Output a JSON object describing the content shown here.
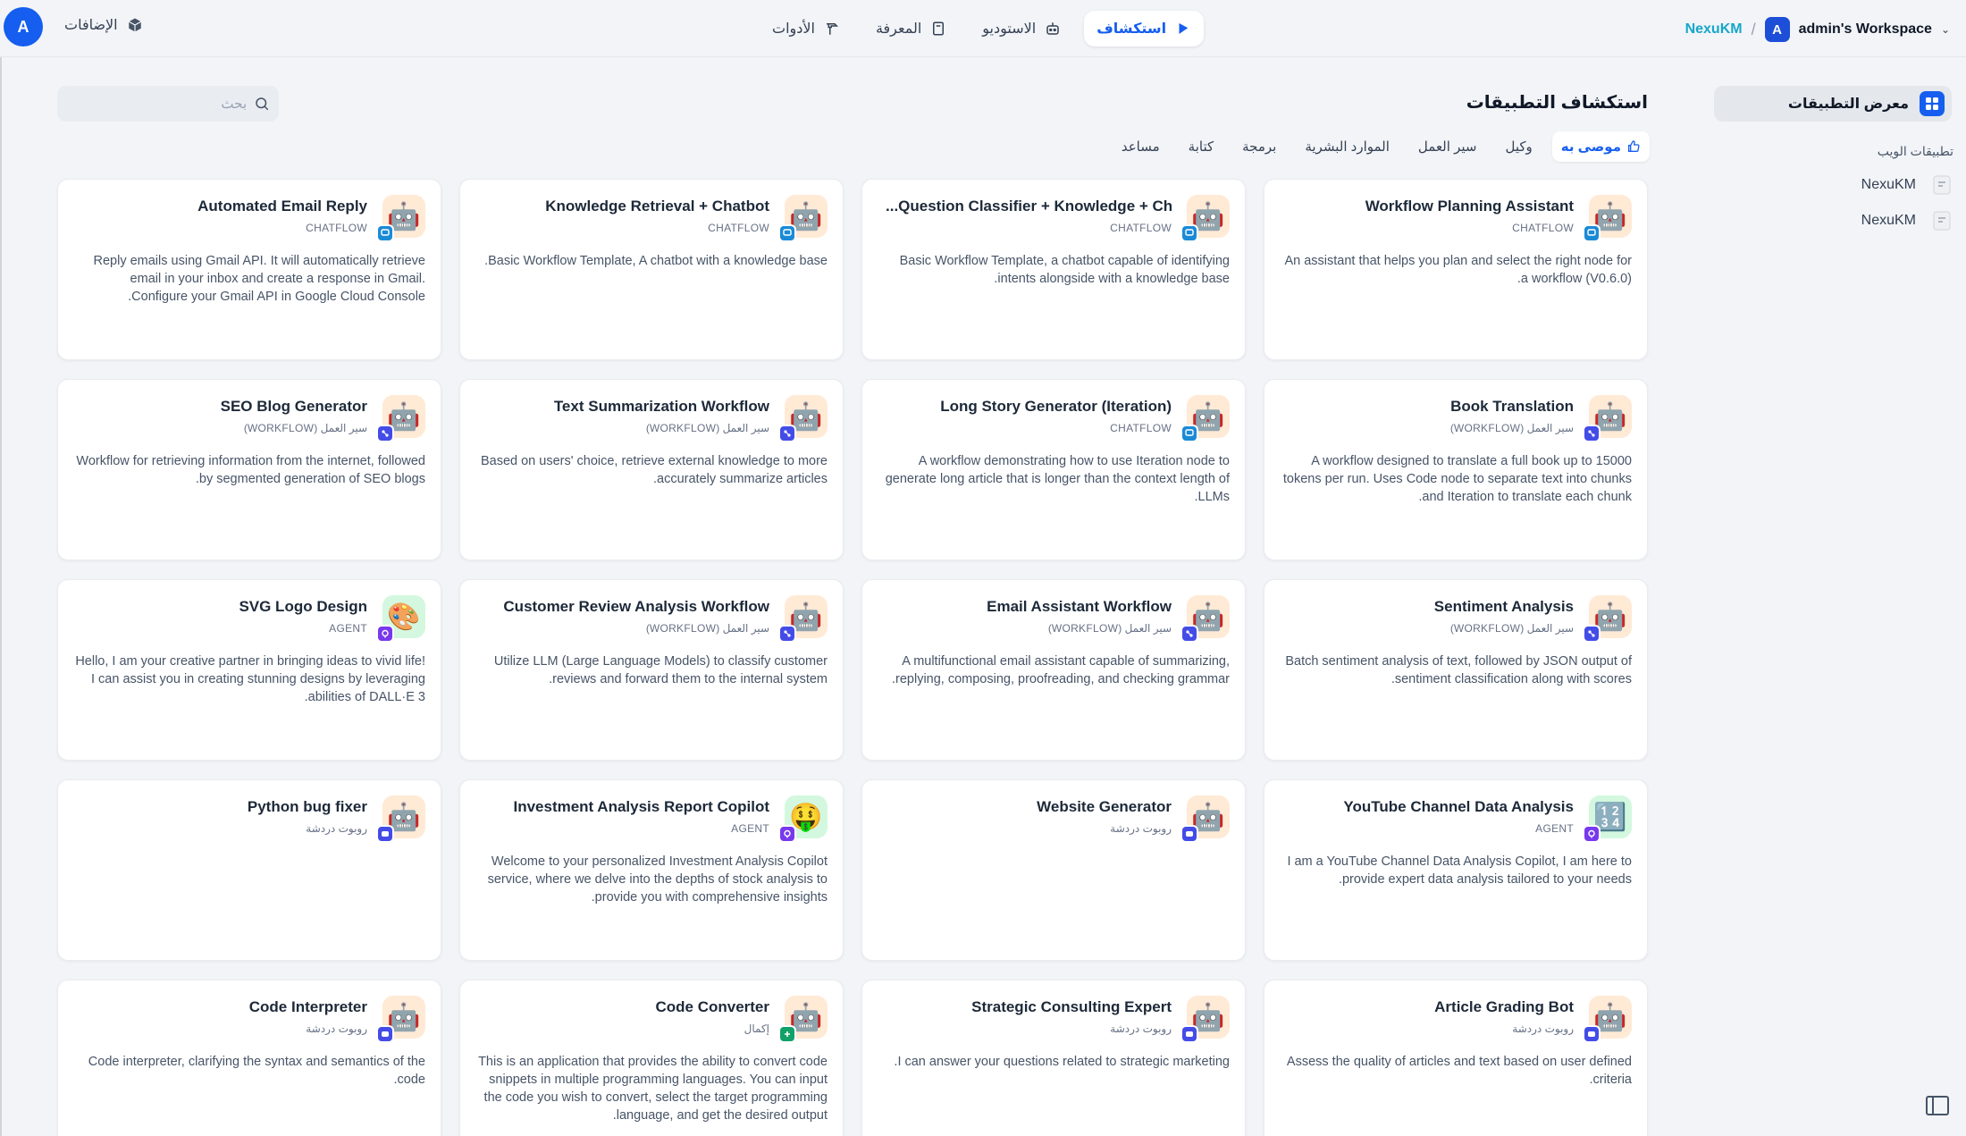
{
  "brand": {
    "logo": "NexuKM",
    "sep": "/",
    "workspace_avatar": "A",
    "workspace_name": "admin's Workspace",
    "chevron": "⌄"
  },
  "nav": [
    {
      "label": "استكشاف",
      "icon": "compass-icon",
      "active": true
    },
    {
      "label": "الاستوديو",
      "icon": "robot-icon",
      "active": false
    },
    {
      "label": "المعرفة",
      "icon": "book-icon",
      "active": false
    },
    {
      "label": "الأدوات",
      "icon": "hammer-icon",
      "active": false
    }
  ],
  "plugins_label": "الإضافات",
  "user_initial": "A",
  "sidebar": {
    "gallery_label": "معرض التطبيقات",
    "section_title": "تطبيقات الويب",
    "apps": [
      "NexuKM",
      "NexuKM"
    ]
  },
  "search": {
    "placeholder": "بحث"
  },
  "page_title": "استكشاف التطبيقات",
  "categories": [
    "موصى به",
    "وكيل",
    "سير العمل",
    "الموارد البشرية",
    "برمجة",
    "كتابة",
    "مساعد"
  ],
  "colors": {
    "accent": "#155eef",
    "workflow_badge": "#444ce7",
    "chatflow_badge": "#1b8ad6",
    "agent_badge": "#7839ee",
    "completion_badge": "#12a168"
  },
  "cards": [
    {
      "name": "Workflow Planning Assistant",
      "type": "CHATFLOW",
      "badge": "chatflow",
      "emoji": "🤖",
      "bg": "#ffead5",
      "desc": "An assistant that helps you plan and select the right node for a workflow (V0.6.0)."
    },
    {
      "name": "...Question Classifier + Knowledge + Chatbot",
      "type": "CHATFLOW",
      "badge": "chatflow",
      "emoji": "🤖",
      "bg": "#ffead5",
      "desc": "Basic Workflow Template, a chatbot capable of identifying intents alongside with a knowledge base."
    },
    {
      "name": "Knowledge Retrieval + Chatbot",
      "type": "CHATFLOW",
      "badge": "chatflow",
      "emoji": "🤖",
      "bg": "#ffead5",
      "desc": "Basic Workflow Template, A chatbot with a knowledge base."
    },
    {
      "name": "Automated Email Reply",
      "type": "CHATFLOW",
      "badge": "chatflow",
      "emoji": "🤖",
      "bg": "#ffead5",
      "desc": "Reply emails using Gmail API. It will automatically retrieve email in your inbox and create a response in Gmail. Configure your Gmail API in Google Cloud Console."
    },
    {
      "name": "Book Translation",
      "type": "سير العمل (WORKFLOW)",
      "badge": "workflow",
      "emoji": "🤖",
      "bg": "#ffead5",
      "desc": "A workflow designed to translate a full book up to 15000 tokens per run. Uses Code node to separate text into chunks and Iteration to translate each chunk."
    },
    {
      "name": "Long Story Generator (Iteration)",
      "type": "CHATFLOW",
      "badge": "chatflow",
      "emoji": "🤖",
      "bg": "#ffead5",
      "desc": "A workflow demonstrating how to use Iteration node to generate long article that is longer than the context length of LLMs."
    },
    {
      "name": "Text Summarization Workflow",
      "type": "سير العمل (WORKFLOW)",
      "badge": "workflow",
      "emoji": "🤖",
      "bg": "#ffead5",
      "desc": "Based on users' choice, retrieve external knowledge to more accurately summarize articles."
    },
    {
      "name": "SEO Blog Generator",
      "type": "سير العمل (WORKFLOW)",
      "badge": "workflow",
      "emoji": "🤖",
      "bg": "#ffead5",
      "desc": "Workflow for retrieving information from the internet, followed by segmented generation of SEO blogs."
    },
    {
      "name": "Sentiment Analysis",
      "type": "سير العمل (WORKFLOW)",
      "badge": "workflow",
      "emoji": "🤖",
      "bg": "#ffead5",
      "desc": "Batch sentiment analysis of text, followed by JSON output of sentiment classification along with scores."
    },
    {
      "name": "Email Assistant Workflow",
      "type": "سير العمل (WORKFLOW)",
      "badge": "workflow",
      "emoji": "🤖",
      "bg": "#ffead5",
      "desc": "A multifunctional email assistant capable of summarizing, replying, composing, proofreading, and checking grammar."
    },
    {
      "name": "Customer Review Analysis Workflow",
      "type": "سير العمل (WORKFLOW)",
      "badge": "workflow",
      "emoji": "🤖",
      "bg": "#ffead5",
      "desc": "Utilize LLM (Large Language Models) to classify customer reviews and forward them to the internal system."
    },
    {
      "name": "SVG Logo Design",
      "type": "AGENT",
      "badge": "agent",
      "emoji": "🎨",
      "bg": "#d3f8df",
      "desc": "Hello, I am your creative partner in bringing ideas to vivid life! I can assist you in creating stunning designs by leveraging abilities of DALL·E 3."
    },
    {
      "name": "YouTube Channel Data Analysis",
      "type": "AGENT",
      "badge": "agent",
      "emoji": "🔢",
      "bg": "#d3f8df",
      "desc": "I am a YouTube Channel Data Analysis Copilot, I am here to provide expert data analysis tailored to your needs."
    },
    {
      "name": "Website Generator",
      "type": "روبوت دردشة",
      "badge": "chat",
      "emoji": "🤖",
      "bg": "#ffead5",
      "desc": ""
    },
    {
      "name": "Investment Analysis Report Copilot",
      "type": "AGENT",
      "badge": "agent",
      "emoji": "🤑",
      "bg": "#d3f8df",
      "desc": "Welcome to your personalized Investment Analysis Copilot service, where we delve into the depths of stock analysis to provide you with comprehensive insights."
    },
    {
      "name": "Python bug fixer",
      "type": "روبوت دردشة",
      "badge": "chat",
      "emoji": "🤖",
      "bg": "#ffead5",
      "desc": ""
    },
    {
      "name": "Article Grading Bot",
      "type": "روبوت دردشة",
      "badge": "chat",
      "emoji": "🤖",
      "bg": "#ffead5",
      "desc": "Assess the quality of articles and text based on user defined criteria."
    },
    {
      "name": "Strategic Consulting Expert",
      "type": "روبوت دردشة",
      "badge": "chat",
      "emoji": "🤖",
      "bg": "#ffead5",
      "desc": "I can answer your questions related to strategic marketing."
    },
    {
      "name": "Code Converter",
      "type": "إكمال",
      "badge": "completion",
      "emoji": "🤖",
      "bg": "#ffead5",
      "desc": "This is an application that provides the ability to convert code snippets in multiple programming languages. You can input the code you wish to convert, select the target programming language, and get the desired output."
    },
    {
      "name": "Code Interpreter",
      "type": "روبوت دردشة",
      "badge": "chat",
      "emoji": "🤖",
      "bg": "#ffead5",
      "desc": "Code interpreter, clarifying the syntax and semantics of the code."
    }
  ]
}
